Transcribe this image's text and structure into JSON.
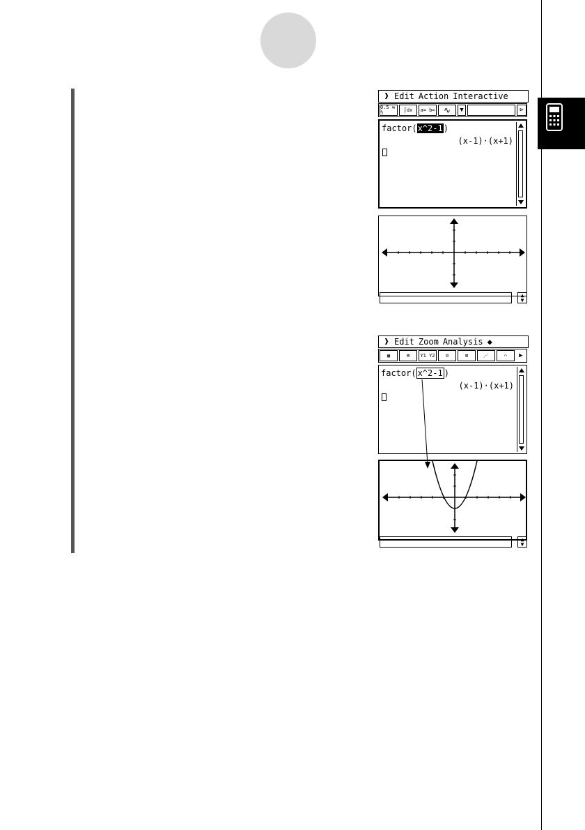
{
  "screen1": {
    "menu": [
      "Edit",
      "Action",
      "Interactive"
    ],
    "toolbar": [
      "0.5 ⇆ ½",
      "∫dx",
      "a= b=",
      "∿"
    ],
    "expression_prefix": "factor(",
    "expression_highlight": "x^2-1",
    "expression_suffix": ")",
    "result": "(x-1)·(x+1)"
  },
  "screen2": {
    "menu": [
      "Edit",
      "Zoom",
      "Analysis",
      "◆"
    ],
    "toolbar": [
      "▦",
      "⊞",
      "Y1 Y2",
      "⊡",
      "⊠",
      "⋰",
      "⌒"
    ],
    "expression_prefix": "factor(",
    "expression_highlight": "x^2-1",
    "expression_suffix": ")",
    "result": "(x-1)·(x+1)"
  },
  "icons": {
    "menu": "down-chevron-icon",
    "side_tab": "calculator-icon"
  }
}
